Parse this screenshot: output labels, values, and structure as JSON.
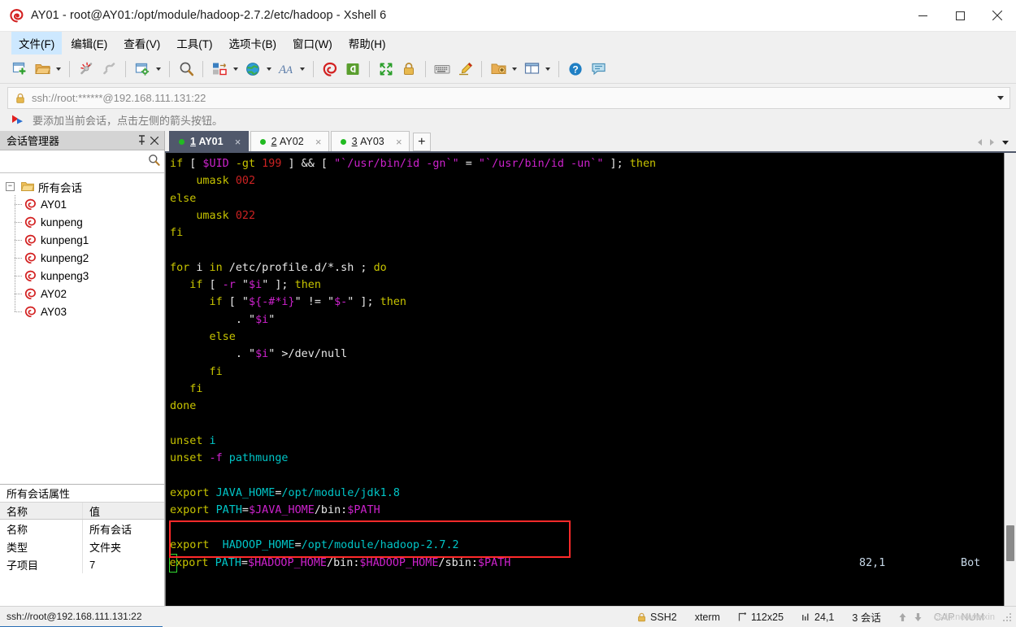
{
  "window": {
    "title": "AY01 - root@AY01:/opt/module/hadoop-2.7.2/etc/hadoop - Xshell 6",
    "app_icon": "xshell-logo-icon",
    "minimize": "—",
    "maximize": "□",
    "close": "✕"
  },
  "menubar": {
    "items": [
      {
        "label": "文件(F)",
        "key": "F",
        "text": "文件(",
        "tail": ")"
      },
      {
        "label": "编辑(E)",
        "key": "E",
        "text": "编辑(",
        "tail": ")"
      },
      {
        "label": "查看(V)",
        "key": "V",
        "text": "查看(",
        "tail": ")"
      },
      {
        "label": "工具(T)",
        "key": "T",
        "text": "工具(",
        "tail": ")"
      },
      {
        "label": "选项卡(B)",
        "key": "B",
        "text": "选项卡(",
        "tail": ")"
      },
      {
        "label": "窗口(W)",
        "key": "W",
        "text": "窗口(",
        "tail": ")"
      },
      {
        "label": "帮助(H)",
        "key": "H",
        "text": "帮助(",
        "tail": ")"
      }
    ]
  },
  "toolbar": {
    "buttons": [
      "new-session-icon",
      "open-folder-icon",
      "open-dropdown-caret",
      "disconnect-icon",
      "reconnect-icon",
      "session-properties-icon",
      "properties-dropdown-caret",
      "find-icon",
      "layout-icon",
      "layout-dropdown-caret",
      "globe-icon",
      "globe-dropdown-caret",
      "font-icon",
      "font-dropdown-caret",
      "xshell-icon",
      "xftp-icon",
      "fullscreen-icon",
      "lock-icon",
      "keyboard-icon",
      "highlight-pen-icon",
      "new-folder-icon",
      "new-folder-dropdown-caret",
      "split-view-icon",
      "split-dropdown-caret",
      "help-icon",
      "chat-icon"
    ]
  },
  "addressbar": {
    "lock_icon": "lock-icon",
    "value": "ssh://root:******@192.168.111.131:22",
    "placeholder": "ssh://",
    "dropdown": "chevron-down-icon"
  },
  "notice": {
    "icon": "red-arrow-flag-icon",
    "text": "要添加当前会话，点击左侧的箭头按钮。"
  },
  "sidebar": {
    "title": "会话管理器",
    "pin_icon": "pin-icon",
    "close_icon": "close-icon",
    "search": {
      "value": "",
      "placeholder": "",
      "icon": "search-icon"
    },
    "tree": {
      "root": {
        "label": "所有会话",
        "icon": "folder-icon",
        "expander": "−"
      },
      "items": [
        {
          "label": "AY01",
          "icon": "session-icon"
        },
        {
          "label": "kunpeng",
          "icon": "session-icon"
        },
        {
          "label": "kunpeng1",
          "icon": "session-icon"
        },
        {
          "label": "kunpeng2",
          "icon": "session-icon"
        },
        {
          "label": "kunpeng3",
          "icon": "session-icon"
        },
        {
          "label": "AY02",
          "icon": "session-icon"
        },
        {
          "label": "AY03",
          "icon": "session-icon"
        }
      ]
    },
    "properties": {
      "title": "所有会话属性",
      "headers": [
        "名称",
        "值"
      ],
      "rows": [
        {
          "name": "名称",
          "value": "所有会话"
        },
        {
          "name": "类型",
          "value": "文件夹"
        },
        {
          "name": "子项目",
          "value": "7"
        }
      ]
    }
  },
  "tabs": {
    "items": [
      {
        "index": "1",
        "label": "AY01",
        "active": true,
        "status": "connected",
        "close": "×"
      },
      {
        "index": "2",
        "label": "AY02",
        "active": false,
        "status": "connected",
        "close": "×"
      },
      {
        "index": "3",
        "label": "AY03",
        "active": false,
        "status": "connected",
        "close": "×"
      }
    ],
    "add_label": "+",
    "nav_left": "chevron-left-icon",
    "nav_right": "chevron-right-icon",
    "nav_menu": "chevron-down-icon"
  },
  "terminal": {
    "cursor_position": "82,1",
    "scroll_indicator": "Bot",
    "highlight_box_color": "#ff2a2a",
    "cursor_color": "#33dd33",
    "background": "#000000",
    "lines": [
      [
        {
          "t": "if ",
          "c": "yellow"
        },
        {
          "t": "[ ",
          "c": "white"
        },
        {
          "t": "$UID",
          "c": "magenta"
        },
        {
          "t": " -gt ",
          "c": "yellow"
        },
        {
          "t": "199",
          "c": "red"
        },
        {
          "t": " ] ",
          "c": "white"
        },
        {
          "t": "&&",
          "c": "white"
        },
        {
          "t": " [ ",
          "c": "white"
        },
        {
          "t": "\"`/usr/bin/id -gn`\"",
          "c": "magenta"
        },
        {
          "t": " = ",
          "c": "white"
        },
        {
          "t": "\"`/usr/bin/id -un`\"",
          "c": "magenta"
        },
        {
          "t": " ]; ",
          "c": "white"
        },
        {
          "t": "then",
          "c": "yellow"
        }
      ],
      [
        {
          "t": "    umask ",
          "c": "yellow"
        },
        {
          "t": "002",
          "c": "red"
        }
      ],
      [
        {
          "t": "else",
          "c": "yellow"
        }
      ],
      [
        {
          "t": "    umask ",
          "c": "yellow"
        },
        {
          "t": "022",
          "c": "red"
        }
      ],
      [
        {
          "t": "fi",
          "c": "yellow"
        }
      ],
      [],
      [
        {
          "t": "for ",
          "c": "yellow"
        },
        {
          "t": "i ",
          "c": "white"
        },
        {
          "t": "in ",
          "c": "yellow"
        },
        {
          "t": "/etc/profile.d/*.sh ; ",
          "c": "white"
        },
        {
          "t": "do",
          "c": "yellow"
        }
      ],
      [
        {
          "t": "   if ",
          "c": "yellow"
        },
        {
          "t": "[ ",
          "c": "white"
        },
        {
          "t": "-r ",
          "c": "magenta"
        },
        {
          "t": "\"",
          "c": "white"
        },
        {
          "t": "$i",
          "c": "magenta"
        },
        {
          "t": "\" ]; ",
          "c": "white"
        },
        {
          "t": "then",
          "c": "yellow"
        }
      ],
      [
        {
          "t": "      if ",
          "c": "yellow"
        },
        {
          "t": "[ \"",
          "c": "white"
        },
        {
          "t": "${-#*i}",
          "c": "magenta"
        },
        {
          "t": "\" != \"",
          "c": "white"
        },
        {
          "t": "$-",
          "c": "magenta"
        },
        {
          "t": "\" ]; ",
          "c": "white"
        },
        {
          "t": "then",
          "c": "yellow"
        }
      ],
      [
        {
          "t": "          . \"",
          "c": "white"
        },
        {
          "t": "$i",
          "c": "magenta"
        },
        {
          "t": "\"",
          "c": "white"
        }
      ],
      [
        {
          "t": "      else",
          "c": "yellow"
        }
      ],
      [
        {
          "t": "          . \"",
          "c": "white"
        },
        {
          "t": "$i",
          "c": "magenta"
        },
        {
          "t": "\" >/dev/null",
          "c": "white"
        }
      ],
      [
        {
          "t": "      fi",
          "c": "yellow"
        }
      ],
      [
        {
          "t": "   fi",
          "c": "yellow"
        }
      ],
      [
        {
          "t": "done",
          "c": "yellow"
        }
      ],
      [],
      [
        {
          "t": "unset ",
          "c": "yellow"
        },
        {
          "t": "i",
          "c": "cyan"
        }
      ],
      [
        {
          "t": "unset ",
          "c": "yellow"
        },
        {
          "t": "-f ",
          "c": "magenta"
        },
        {
          "t": "pathmunge",
          "c": "cyan"
        }
      ],
      [],
      [
        {
          "t": "export ",
          "c": "yellow"
        },
        {
          "t": "JAVA_HOME",
          "c": "cyan"
        },
        {
          "t": "=",
          "c": "white"
        },
        {
          "t": "/opt/module/jdk1.8",
          "c": "cyan"
        }
      ],
      [
        {
          "t": "export ",
          "c": "yellow"
        },
        {
          "t": "PATH",
          "c": "cyan"
        },
        {
          "t": "=",
          "c": "white"
        },
        {
          "t": "$JAVA_HOME",
          "c": "magenta"
        },
        {
          "t": "/bin:",
          "c": "white"
        },
        {
          "t": "$PATH",
          "c": "magenta"
        }
      ],
      [],
      [
        {
          "t": "export  ",
          "c": "yellow"
        },
        {
          "t": "HADOOP_HOME",
          "c": "cyan"
        },
        {
          "t": "=",
          "c": "white"
        },
        {
          "t": "/opt/module/hadoop-2.7.2",
          "c": "cyan"
        }
      ],
      [
        {
          "t": "e",
          "c": "cursor"
        },
        {
          "t": "xport ",
          "c": "yellow"
        },
        {
          "t": "PATH",
          "c": "cyan"
        },
        {
          "t": "=",
          "c": "white"
        },
        {
          "t": "$HADOOP_HOME",
          "c": "magenta"
        },
        {
          "t": "/bin:",
          "c": "white"
        },
        {
          "t": "$HADOOP_HOME",
          "c": "magenta"
        },
        {
          "t": "/sbin:",
          "c": "white"
        },
        {
          "t": "$PATH",
          "c": "magenta"
        }
      ]
    ]
  },
  "statusbar": {
    "connection": "ssh://root@192.168.111.131:22",
    "protocol": "SSH2",
    "protocol_icon": "lock-icon",
    "terminal_type": "xterm",
    "size": "112x25",
    "size_icon": "resize-icon",
    "cursor": "24,1",
    "cursor_icon": "column-icon",
    "sessions": "3 会话",
    "up_icon": "arrow-up-icon",
    "down_icon": "arrow-down-icon",
    "caps": "CAP",
    "num": "NUM",
    "watermark": "csdn.net/weixin"
  }
}
